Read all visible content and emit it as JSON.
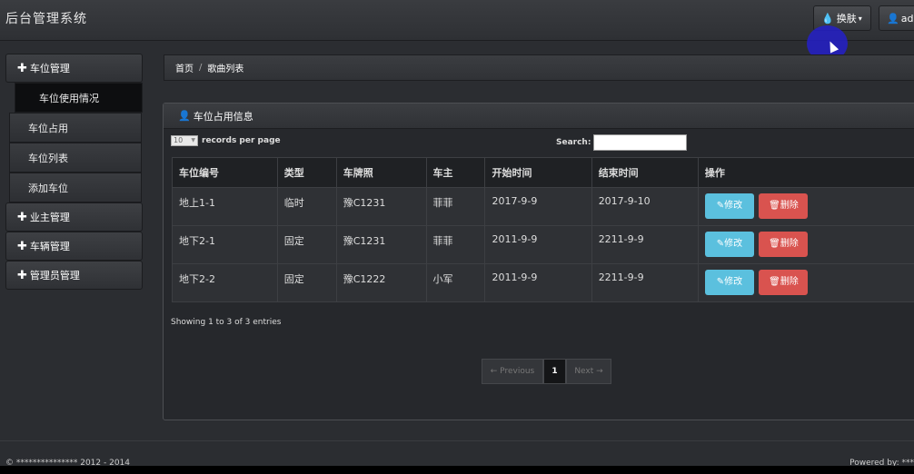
{
  "header": {
    "title": "后台管理系统",
    "skin_label": "换肤",
    "user_label": "adm"
  },
  "sidebar": {
    "groups": [
      {
        "label": "车位管理"
      },
      {
        "label": "业主管理"
      },
      {
        "label": "车辆管理"
      },
      {
        "label": "管理员管理"
      }
    ],
    "sub_items": [
      {
        "label": "车位使用情况"
      },
      {
        "label": "车位占用"
      },
      {
        "label": "车位列表"
      },
      {
        "label": "添加车位"
      }
    ]
  },
  "breadcrumb": {
    "home": "首页",
    "separator": "/",
    "current": "歌曲列表"
  },
  "panel": {
    "title": "车位占用信息",
    "length_value": "10",
    "length_suffix": "records per page",
    "search_label": "Search:",
    "search_value": "",
    "columns": [
      "车位编号",
      "类型",
      "车牌照",
      "车主",
      "开始时间",
      "结束时间",
      "操作"
    ],
    "rows": [
      [
        "地上1-1",
        "临时",
        "豫C1231",
        "菲菲",
        "2017-9-9",
        "2017-9-10"
      ],
      [
        "地下2-1",
        "固定",
        "豫C1231",
        "菲菲",
        "2011-9-9",
        "2211-9-9"
      ],
      [
        "地下2-2",
        "固定",
        "豫C1222",
        "小军",
        "2011-9-9",
        "2211-9-9"
      ]
    ],
    "edit_label": "修改",
    "delete_label": "删除",
    "info": "Showing 1 to 3 of 3 entries",
    "pager": {
      "prev": "← Previous",
      "current": "1",
      "next": "Next →"
    }
  },
  "footer": {
    "copyright": "© *************** 2012 - 2014",
    "powered": "Powered by: ***"
  }
}
